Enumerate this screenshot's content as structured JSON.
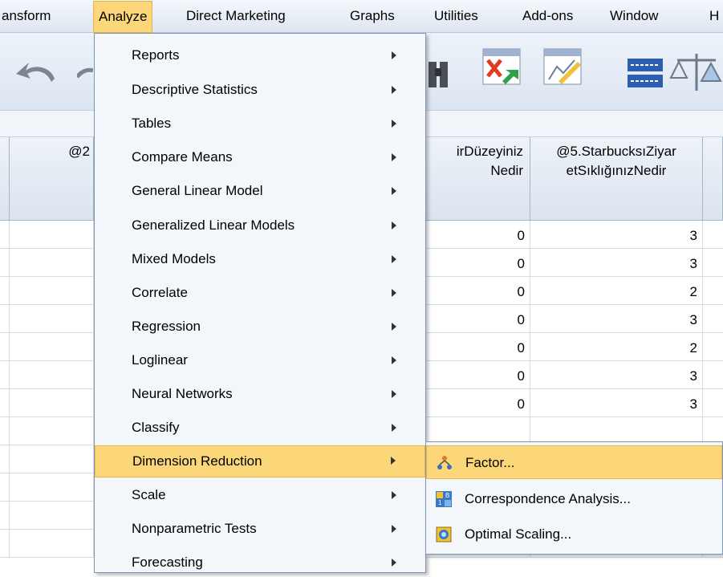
{
  "menubar": {
    "items": [
      {
        "label": "ansform"
      },
      {
        "label": "Analyze",
        "active": true
      },
      {
        "label": "Direct Marketing"
      },
      {
        "label": "Graphs"
      },
      {
        "label": "Utilities"
      },
      {
        "label": "Add-ons"
      },
      {
        "label": "Window"
      },
      {
        "label": "H"
      }
    ]
  },
  "grid": {
    "header_partial_left": "@2",
    "header_col3_line1": "irDüzeyiniz",
    "header_col3_line2": "Nedir",
    "header_col4_line1": "@5.StarbucksıZiyar",
    "header_col4_line2": "etSıklığınızNedir",
    "rows": [
      {
        "c3": "0",
        "c4": "3"
      },
      {
        "c3": "0",
        "c4": "3"
      },
      {
        "c3": "0",
        "c4": "2"
      },
      {
        "c3": "0",
        "c4": "3"
      },
      {
        "c3": "0",
        "c4": "2"
      },
      {
        "c3": "0",
        "c4": "3"
      },
      {
        "c3": "0",
        "c4": "3"
      }
    ]
  },
  "analyze_menu": {
    "items": [
      {
        "label": "Reports",
        "has_submenu": true
      },
      {
        "label": "Descriptive Statistics",
        "has_submenu": true
      },
      {
        "label": "Tables",
        "has_submenu": true
      },
      {
        "label": "Compare Means",
        "has_submenu": true
      },
      {
        "label": "General Linear Model",
        "has_submenu": true
      },
      {
        "label": "Generalized Linear Models",
        "has_submenu": true
      },
      {
        "label": "Mixed Models",
        "has_submenu": true
      },
      {
        "label": "Correlate",
        "has_submenu": true
      },
      {
        "label": "Regression",
        "has_submenu": true
      },
      {
        "label": "Loglinear",
        "has_submenu": true
      },
      {
        "label": "Neural Networks",
        "has_submenu": true
      },
      {
        "label": "Classify",
        "has_submenu": true
      },
      {
        "label": "Dimension Reduction",
        "has_submenu": true,
        "highlighted": true
      },
      {
        "label": "Scale",
        "has_submenu": true
      },
      {
        "label": "Nonparametric Tests",
        "has_submenu": true
      },
      {
        "label": "Forecasting",
        "has_submenu": true
      }
    ]
  },
  "dimension_reduction_submenu": {
    "items": [
      {
        "label": "Factor...",
        "icon": "factor-icon",
        "highlighted": true
      },
      {
        "label": "Correspondence Analysis...",
        "icon": "correspondence-icon"
      },
      {
        "label": "Optimal Scaling...",
        "icon": "optimal-scaling-icon"
      }
    ]
  },
  "colors": {
    "highlight": "#fcd77a",
    "menu_bg": "#f3f6fa",
    "menu_border": "#7f95b0"
  }
}
